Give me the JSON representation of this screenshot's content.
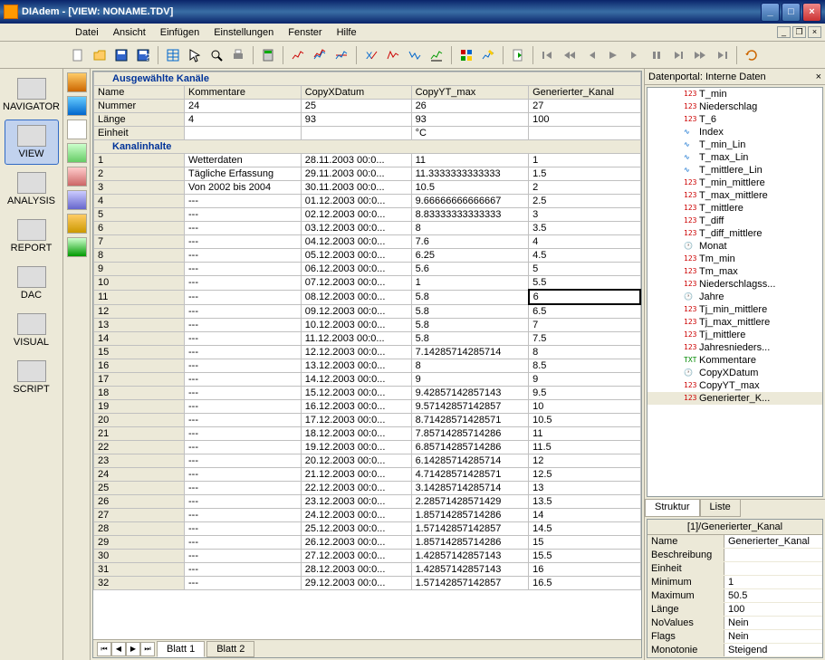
{
  "window": {
    "title": "DIAdem - [VIEW:   NONAME.TDV]"
  },
  "menu": [
    "Datei",
    "Ansicht",
    "Einfügen",
    "Einstellungen",
    "Fenster",
    "Hilfe"
  ],
  "nav": [
    {
      "label": "NAVIGATOR"
    },
    {
      "label": "VIEW"
    },
    {
      "label": "ANALYSIS"
    },
    {
      "label": "REPORT"
    },
    {
      "label": "DAC"
    },
    {
      "label": "VISUAL"
    },
    {
      "label": "SCRIPT"
    }
  ],
  "section1_title": "Ausgewählte Kanäle",
  "section2_title": "Kanalinhalte",
  "headers": [
    "Name",
    "Kommentare",
    "CopyXDatum",
    "CopyYT_max",
    "Generierter_Kanal"
  ],
  "meta_rows": [
    [
      "Nummer",
      "24",
      "25",
      "26",
      "27"
    ],
    [
      "Länge",
      "4",
      "93",
      "93",
      "100"
    ],
    [
      "Einheit",
      "",
      "",
      "°C",
      ""
    ]
  ],
  "data_rows": [
    [
      "1",
      "Wetterdaten",
      "28.11.2003 00:0...",
      "11",
      "1"
    ],
    [
      "2",
      "Tägliche Erfassung",
      "29.11.2003 00:0...",
      "11.3333333333333",
      "1.5"
    ],
    [
      "3",
      "Von 2002 bis 2004",
      "30.11.2003 00:0...",
      "10.5",
      "2"
    ],
    [
      "4",
      "---",
      "01.12.2003 00:0...",
      "9.66666666666667",
      "2.5"
    ],
    [
      "5",
      "---",
      "02.12.2003 00:0...",
      "8.83333333333333",
      "3"
    ],
    [
      "6",
      "---",
      "03.12.2003 00:0...",
      "8",
      "3.5"
    ],
    [
      "7",
      "---",
      "04.12.2003 00:0...",
      "7.6",
      "4"
    ],
    [
      "8",
      "---",
      "05.12.2003 00:0...",
      "6.25",
      "4.5"
    ],
    [
      "9",
      "---",
      "06.12.2003 00:0...",
      "5.6",
      "5"
    ],
    [
      "10",
      "---",
      "07.12.2003 00:0...",
      "1",
      "5.5"
    ],
    [
      "11",
      "---",
      "08.12.2003 00:0...",
      "5.8",
      "6"
    ],
    [
      "12",
      "---",
      "09.12.2003 00:0...",
      "5.8",
      "6.5"
    ],
    [
      "13",
      "---",
      "10.12.2003 00:0...",
      "5.8",
      "7"
    ],
    [
      "14",
      "---",
      "11.12.2003 00:0...",
      "5.8",
      "7.5"
    ],
    [
      "15",
      "---",
      "12.12.2003 00:0...",
      "7.14285714285714",
      "8"
    ],
    [
      "16",
      "---",
      "13.12.2003 00:0...",
      "8",
      "8.5"
    ],
    [
      "17",
      "---",
      "14.12.2003 00:0...",
      "9",
      "9"
    ],
    [
      "18",
      "---",
      "15.12.2003 00:0...",
      "9.42857142857143",
      "9.5"
    ],
    [
      "19",
      "---",
      "16.12.2003 00:0...",
      "9.57142857142857",
      "10"
    ],
    [
      "20",
      "---",
      "17.12.2003 00:0...",
      "8.71428571428571",
      "10.5"
    ],
    [
      "21",
      "---",
      "18.12.2003 00:0...",
      "7.85714285714286",
      "11"
    ],
    [
      "22",
      "---",
      "19.12.2003 00:0...",
      "6.85714285714286",
      "11.5"
    ],
    [
      "23",
      "---",
      "20.12.2003 00:0...",
      "6.14285714285714",
      "12"
    ],
    [
      "24",
      "---",
      "21.12.2003 00:0...",
      "4.71428571428571",
      "12.5"
    ],
    [
      "25",
      "---",
      "22.12.2003 00:0...",
      "3.14285714285714",
      "13"
    ],
    [
      "26",
      "---",
      "23.12.2003 00:0...",
      "2.28571428571429",
      "13.5"
    ],
    [
      "27",
      "---",
      "24.12.2003 00:0...",
      "1.85714285714286",
      "14"
    ],
    [
      "28",
      "---",
      "25.12.2003 00:0...",
      "1.57142857142857",
      "14.5"
    ],
    [
      "29",
      "---",
      "26.12.2003 00:0...",
      "1.85714285714286",
      "15"
    ],
    [
      "30",
      "---",
      "27.12.2003 00:0...",
      "1.42857142857143",
      "15.5"
    ],
    [
      "31",
      "---",
      "28.12.2003 00:0...",
      "1.42857142857143",
      "16"
    ],
    [
      "32",
      "---",
      "29.12.2003 00:0...",
      "1.57142857142857",
      "16.5"
    ]
  ],
  "sheet_tabs": [
    "Blatt 1",
    "Blatt 2"
  ],
  "portal_title": "Datenportal: Interne Daten",
  "tree": [
    {
      "icon": "num",
      "label": "T_min"
    },
    {
      "icon": "num",
      "label": "Niederschlag"
    },
    {
      "icon": "num",
      "label": "T_6"
    },
    {
      "icon": "wave",
      "label": "Index"
    },
    {
      "icon": "wave",
      "label": "T_min_Lin"
    },
    {
      "icon": "wave",
      "label": "T_max_Lin"
    },
    {
      "icon": "wave",
      "label": "T_mittlere_Lin"
    },
    {
      "icon": "num",
      "label": "T_min_mittlere"
    },
    {
      "icon": "num",
      "label": "T_max_mittlere"
    },
    {
      "icon": "num",
      "label": "T_mittlere"
    },
    {
      "icon": "num",
      "label": "T_diff"
    },
    {
      "icon": "num",
      "label": "T_diff_mittlere"
    },
    {
      "icon": "clock",
      "label": "Monat"
    },
    {
      "icon": "num",
      "label": "Tm_min"
    },
    {
      "icon": "num",
      "label": "Tm_max"
    },
    {
      "icon": "num",
      "label": "Niederschlagss..."
    },
    {
      "icon": "clock",
      "label": "Jahre"
    },
    {
      "icon": "num",
      "label": "Tj_min_mittlere"
    },
    {
      "icon": "num",
      "label": "Tj_max_mittlere"
    },
    {
      "icon": "num",
      "label": "Tj_mittlere"
    },
    {
      "icon": "num",
      "label": "Jahresnieders..."
    },
    {
      "icon": "txt",
      "label": "Kommentare"
    },
    {
      "icon": "clock",
      "label": "CopyXDatum"
    },
    {
      "icon": "num",
      "label": "CopyYT_max"
    },
    {
      "icon": "num",
      "label": "Generierter_K...",
      "sel": true
    }
  ],
  "right_tabs": [
    "Struktur",
    "Liste"
  ],
  "prop_title": "[1]/Generierter_Kanal",
  "props": [
    [
      "Name",
      "Generierter_Kanal"
    ],
    [
      "Beschreibung",
      ""
    ],
    [
      "Einheit",
      ""
    ],
    [
      "Minimum",
      "1"
    ],
    [
      "Maximum",
      "50.5"
    ],
    [
      "Länge",
      "100"
    ],
    [
      "NoValues",
      "Nein"
    ],
    [
      "Flags",
      "Nein"
    ],
    [
      "Monotonie",
      "Steigend"
    ]
  ]
}
